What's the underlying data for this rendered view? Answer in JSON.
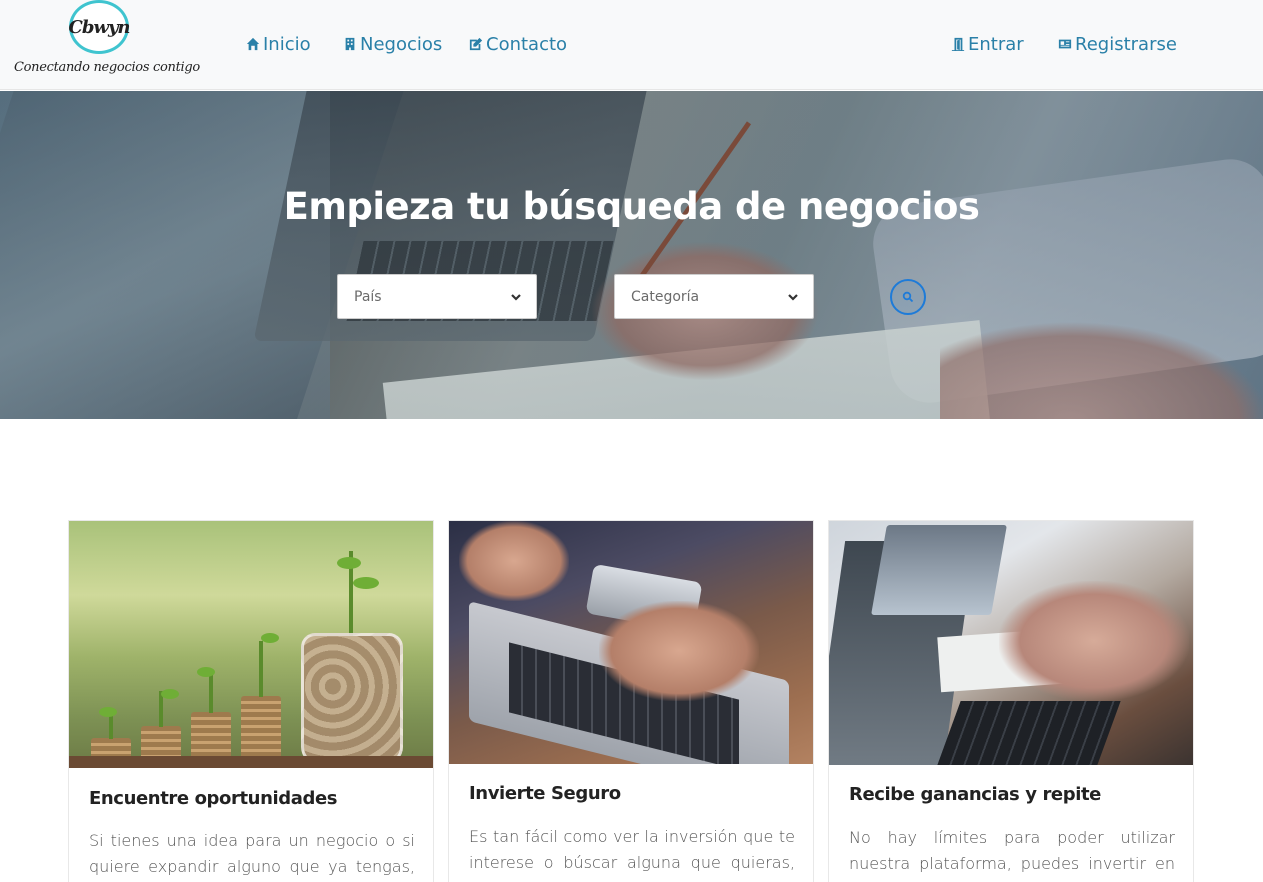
{
  "navbar": {
    "logo_text": "Cbwyn",
    "logo_tagline": "Conectando negocios contigo",
    "links": [
      {
        "label": "Inicio",
        "icon": "home-icon"
      },
      {
        "label": "Negocios",
        "icon": "building-icon"
      },
      {
        "label": "Contacto",
        "icon": "edit-icon"
      }
    ],
    "auth": [
      {
        "label": "Entrar",
        "icon": "door-icon"
      },
      {
        "label": "Registrarse",
        "icon": "id-card-icon"
      }
    ],
    "link_color": "#2a80a8"
  },
  "hero": {
    "title": "Empieza tu búsqueda de negocios",
    "country_select": {
      "value": "País"
    },
    "category_select": {
      "value": "Categoría"
    },
    "search_icon": "search-icon",
    "accent": "#1e7bd8"
  },
  "cards": [
    {
      "title": "Encuentre oportunidades",
      "text": "Si tienes una idea para un negocio o si quiere expandir alguno que ya tengas, Puedes",
      "image": "coins-and-plants-photo"
    },
    {
      "title": "Invierte Seguro",
      "text": "Es tan fácil como ver la inversión que te interese o búscar alguna que quieras, darle al",
      "image": "phone-and-laptop-photo"
    },
    {
      "title": "Recibe ganancias y repite",
      "text": "No hay límites para poder utilizar nuestra plataforma, puedes invertir en una variada",
      "image": "business-meeting-photo"
    }
  ]
}
